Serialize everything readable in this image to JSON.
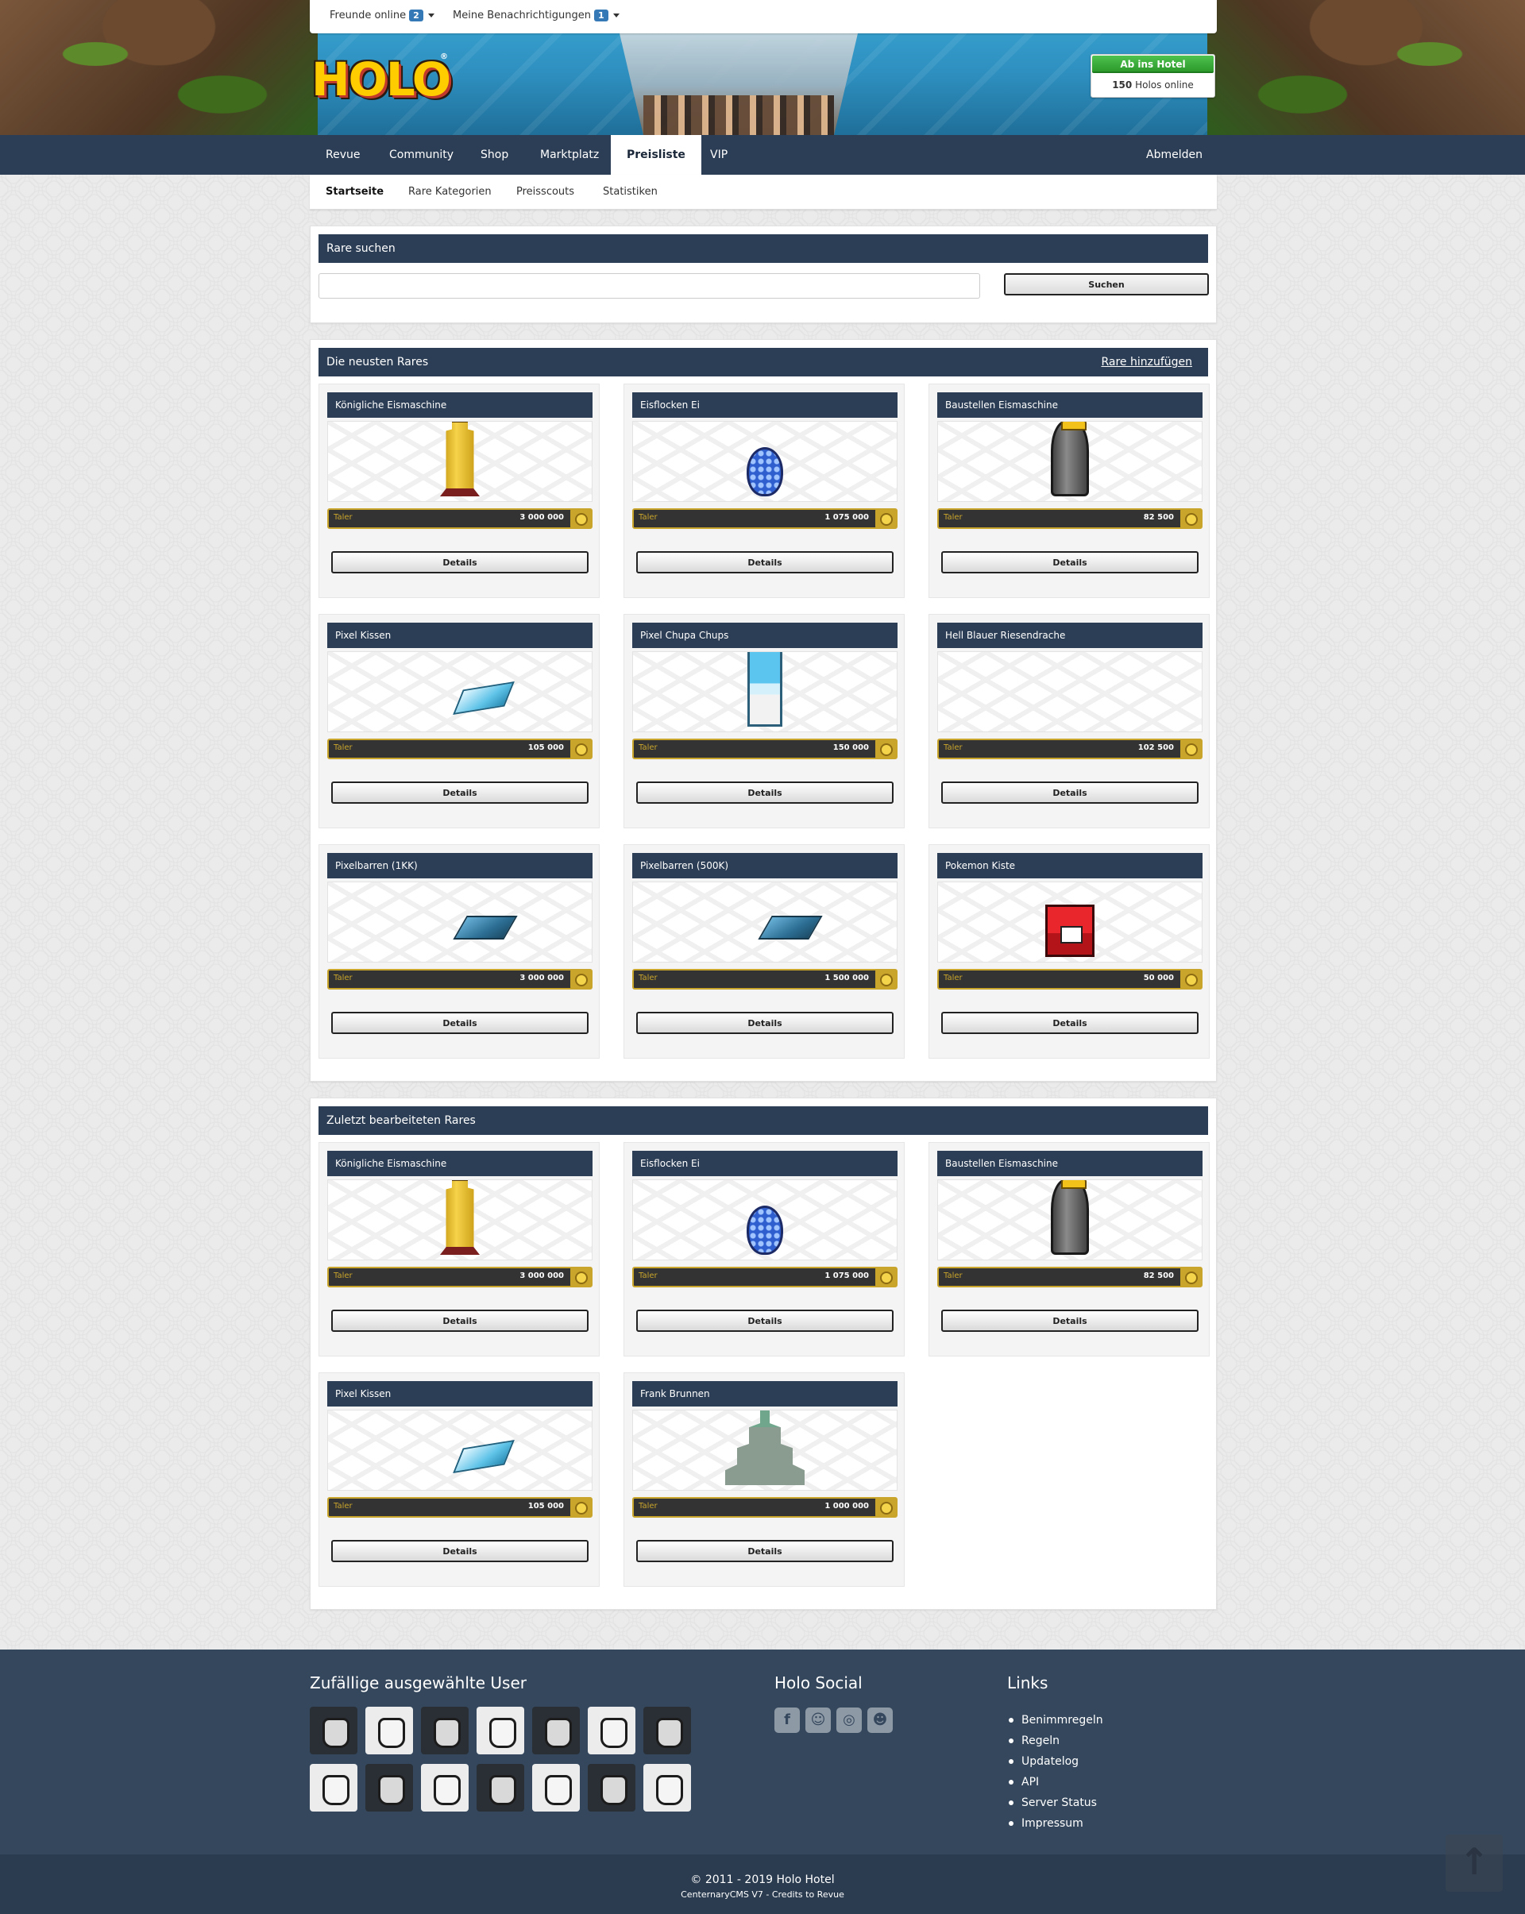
{
  "topbar": {
    "friends_label": "Freunde online",
    "friends_count": "2",
    "notifications_label": "Meine Benachrichtigungen",
    "notifications_count": "1"
  },
  "header": {
    "logo_text": "HOLO",
    "hotel_button": "Ab ins Hotel",
    "online_count": "150",
    "online_label": "Holos online"
  },
  "nav": {
    "items": [
      "Revue",
      "Community",
      "Shop",
      "Marktplatz",
      "Preisliste",
      "VIP"
    ],
    "active": "Preisliste",
    "logout": "Abmelden"
  },
  "subnav": {
    "items": [
      "Startseite",
      "Rare Kategorien",
      "Preisscouts",
      "Statistiken"
    ],
    "active": "Startseite"
  },
  "search": {
    "title": "Rare suchen",
    "placeholder": "",
    "value": "",
    "button": "Suchen"
  },
  "newest": {
    "title": "Die neusten Rares",
    "add_link": "Rare hinzufügen",
    "items": [
      {
        "name": "Königliche Eismaschine",
        "currency": "Taler",
        "price": "3 000 000",
        "button": "Details",
        "icon": "gold-ice-machine"
      },
      {
        "name": "Eisflocken Ei",
        "currency": "Taler",
        "price": "1 075 000",
        "button": "Details",
        "icon": "snowflake-egg"
      },
      {
        "name": "Baustellen Eismaschine",
        "currency": "Taler",
        "price": "82 500",
        "button": "Details",
        "icon": "construction-ice-machine"
      },
      {
        "name": "Pixel Kissen",
        "currency": "Taler",
        "price": "105 000",
        "button": "Details",
        "icon": "pixel-pillow"
      },
      {
        "name": "Pixel Chupa Chups",
        "currency": "Taler",
        "price": "150 000",
        "button": "Details",
        "icon": "pixel-chupa-chups"
      },
      {
        "name": "Hell Blauer Riesendrache",
        "currency": "Taler",
        "price": "102 500",
        "button": "Details",
        "icon": "none"
      },
      {
        "name": "Pixelbarren (1KK)",
        "currency": "Taler",
        "price": "3 000 000",
        "button": "Details",
        "icon": "pixel-bar"
      },
      {
        "name": "Pixelbarren (500K)",
        "currency": "Taler",
        "price": "1 500 000",
        "button": "Details",
        "icon": "pixel-bar"
      },
      {
        "name": "Pokemon Kiste",
        "currency": "Taler",
        "price": "50 000",
        "button": "Details",
        "icon": "pokemon-box"
      }
    ]
  },
  "edited": {
    "title": "Zuletzt bearbeiteten Rares",
    "items": [
      {
        "name": "Königliche Eismaschine",
        "currency": "Taler",
        "price": "3 000 000",
        "button": "Details",
        "icon": "gold-ice-machine"
      },
      {
        "name": "Eisflocken Ei",
        "currency": "Taler",
        "price": "1 075 000",
        "button": "Details",
        "icon": "snowflake-egg"
      },
      {
        "name": "Baustellen Eismaschine",
        "currency": "Taler",
        "price": "82 500",
        "button": "Details",
        "icon": "construction-ice-machine"
      },
      {
        "name": "Pixel Kissen",
        "currency": "Taler",
        "price": "105 000",
        "button": "Details",
        "icon": "pixel-pillow"
      },
      {
        "name": "Frank Brunnen",
        "currency": "Taler",
        "price": "1 000 000",
        "button": "Details",
        "icon": "frank-fountain"
      }
    ]
  },
  "footer": {
    "users_title": "Zufällige ausgewählte User",
    "social_title": "Holo Social",
    "social_icons": [
      "facebook-icon",
      "snapchat-icon",
      "instagram-icon",
      "discord-icon"
    ],
    "links_title": "Links",
    "links": [
      "Benimmregeln",
      "Regeln",
      "Updatelog",
      "API",
      "Server Status",
      "Impressum"
    ],
    "copyright": "© 2011 - 2019 Holo Hotel",
    "credits": "CenternaryCMS V7 - Credits to Revue"
  },
  "colors": {
    "nav": "#2c3e55",
    "footer": "#34475c",
    "gold": "#c9a52b",
    "hotel_button": "#2c9a2c"
  }
}
